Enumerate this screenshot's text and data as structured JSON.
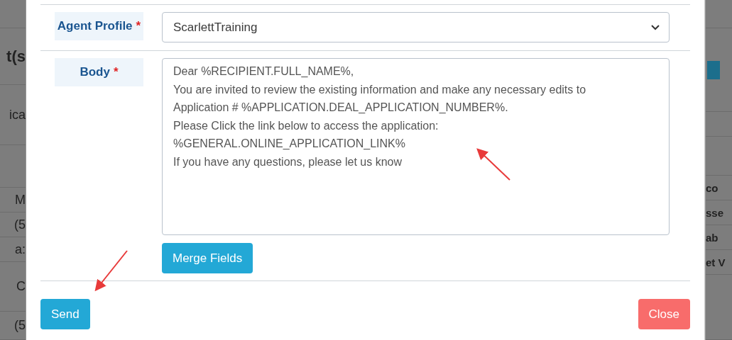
{
  "backdrop": {
    "left": [
      "t(s",
      "ica",
      "M",
      "(5",
      "a:",
      "C",
      "(5"
    ],
    "right": [
      "co",
      "sse",
      "ab",
      "et V"
    ]
  },
  "form": {
    "rows": [
      {
        "kind": "select",
        "label": "Agent Profile",
        "required_mark": "*",
        "value": "ScarlettTraining"
      },
      {
        "kind": "textarea",
        "label": "Body",
        "required_mark": "*",
        "lines": [
          "Dear %RECIPIENT.FULL_NAME%,",
          "You are invited to review the existing information and make any necessary edits to",
          "Application # %APPLICATION.DEAL_APPLICATION_NUMBER%.",
          "Please Click the link below to access the application:",
          "%GENERAL.ONLINE_APPLICATION_LINK%",
          "If you have any questions, please let us know"
        ],
        "button": "Merge Fields"
      }
    ]
  },
  "footer": {
    "buttons": [
      {
        "label": "Send",
        "kind": "primary"
      },
      {
        "label": "Close",
        "kind": "danger"
      }
    ]
  }
}
